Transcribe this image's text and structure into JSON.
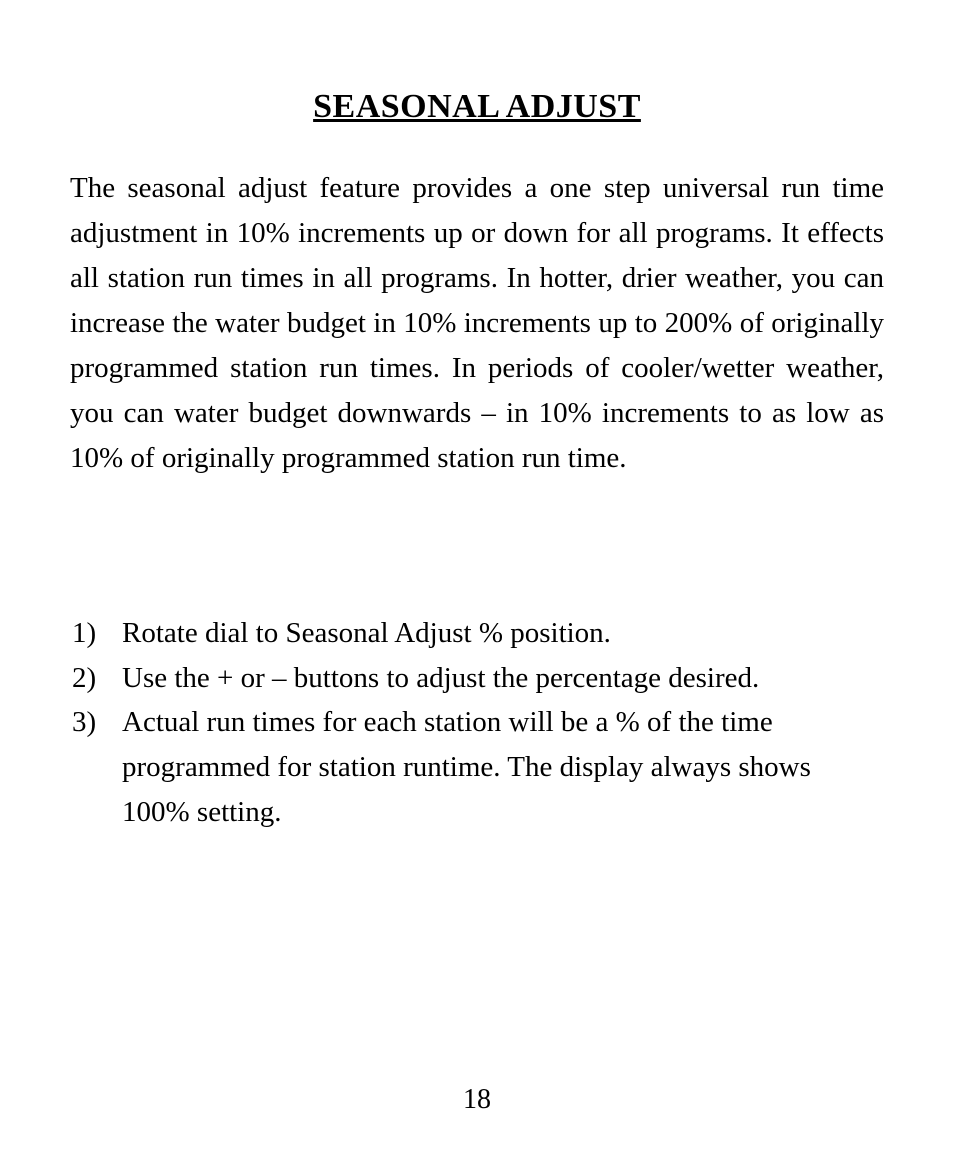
{
  "title": "SEASONAL ADJUST",
  "body": "The seasonal adjust feature provides a one step universal run time adjustment in 10% increments up or down for all programs. It effects all station run times in all programs. In hotter, drier weather, you can increase the water budget in 10% increments up to 200% of originally programmed station run times. In periods of cooler/wetter weather, you can water budget downwards – in 10% increments to as low as 10% of originally programmed station run time.",
  "instructions": [
    {
      "num": "1)",
      "text": "Rotate dial to Seasonal Adjust % position."
    },
    {
      "num": "2)",
      "text": "Use the + or – buttons to adjust the percentage desired."
    },
    {
      "num": "3)",
      "text": "Actual run times for each station will be a % of the time programmed for station runtime. The display always shows 100% setting."
    }
  ],
  "pageNumber": "18"
}
